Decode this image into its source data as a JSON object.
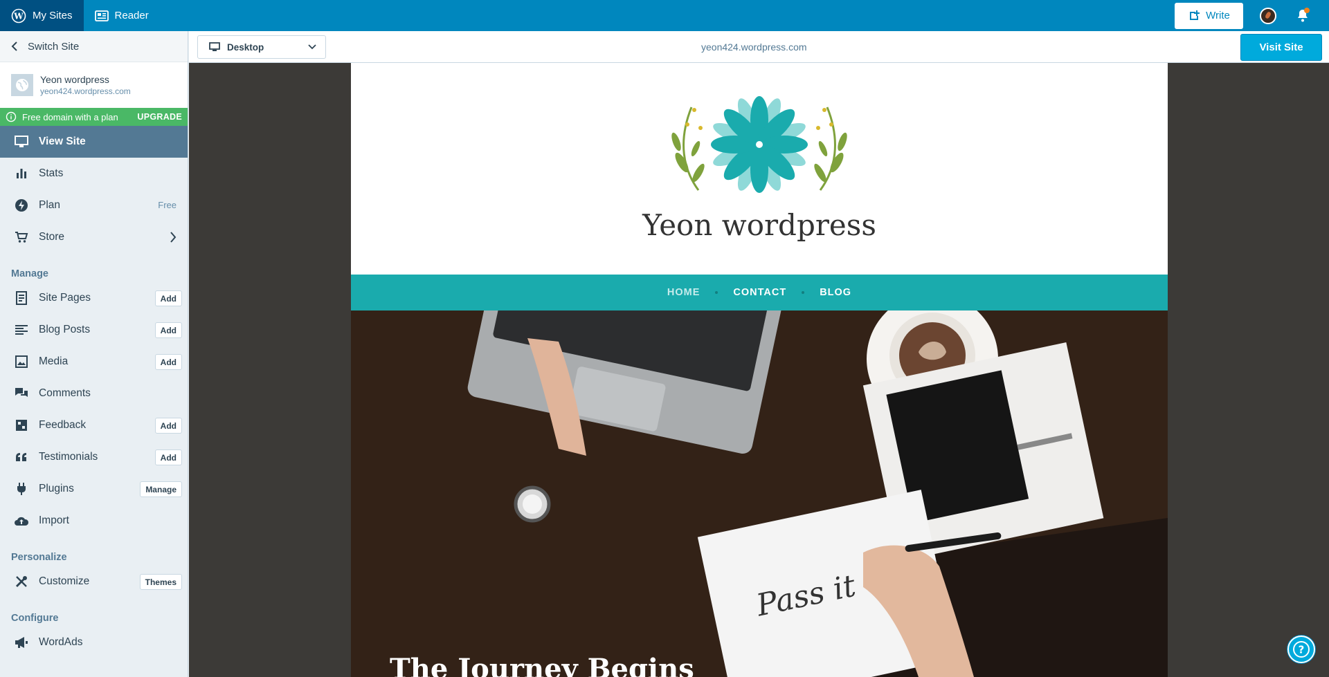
{
  "masterbar": {
    "my_sites": "My Sites",
    "reader": "Reader",
    "write": "Write"
  },
  "sidebar": {
    "switch_site": "Switch Site",
    "site": {
      "name": "Yeon wordpress",
      "domain": "yeon424.wordpress.com"
    },
    "promo": {
      "text": "Free domain with a plan",
      "action": "UPGRADE"
    },
    "items": [
      {
        "label": "View Site",
        "icon": "monitor-icon",
        "selected": true
      },
      {
        "label": "Stats",
        "icon": "stats-icon"
      },
      {
        "label": "Plan",
        "icon": "plan-icon",
        "side_text": "Free"
      },
      {
        "label": "Store",
        "icon": "cart-icon"
      }
    ],
    "sections": {
      "manage": "Manage",
      "personalize": "Personalize",
      "configure": "Configure"
    },
    "manage_items": [
      {
        "label": "Site Pages",
        "badge": "Add",
        "icon": "pages-icon"
      },
      {
        "label": "Blog Posts",
        "badge": "Add",
        "icon": "posts-icon"
      },
      {
        "label": "Media",
        "badge": "Add",
        "icon": "media-icon"
      },
      {
        "label": "Comments",
        "icon": "comments-icon"
      },
      {
        "label": "Feedback",
        "badge": "Add",
        "icon": "feedback-icon"
      },
      {
        "label": "Testimonials",
        "badge": "Add",
        "icon": "quote-icon"
      },
      {
        "label": "Plugins",
        "badge": "Manage",
        "icon": "plugin-icon"
      },
      {
        "label": "Import",
        "icon": "cloud-upload-icon"
      }
    ],
    "personalize_items": [
      {
        "label": "Customize",
        "badge": "Themes",
        "icon": "tools-icon"
      }
    ],
    "configure_items": [
      {
        "label": "WordAds",
        "icon": "megaphone-icon"
      }
    ]
  },
  "preview": {
    "device": "Desktop",
    "url": "yeon424.wordpress.com",
    "visit": "Visit Site"
  },
  "site_preview": {
    "title": "Yeon wordpress",
    "nav": [
      "HOME",
      "CONTACT",
      "BLOG"
    ],
    "hero_title": "The Journey Begins",
    "accent": "#1aabad"
  },
  "colors": {
    "masterbar": "#0087be",
    "sidebar_selected": "#537994",
    "promo": "#4ab866",
    "button": "#00aadc"
  }
}
